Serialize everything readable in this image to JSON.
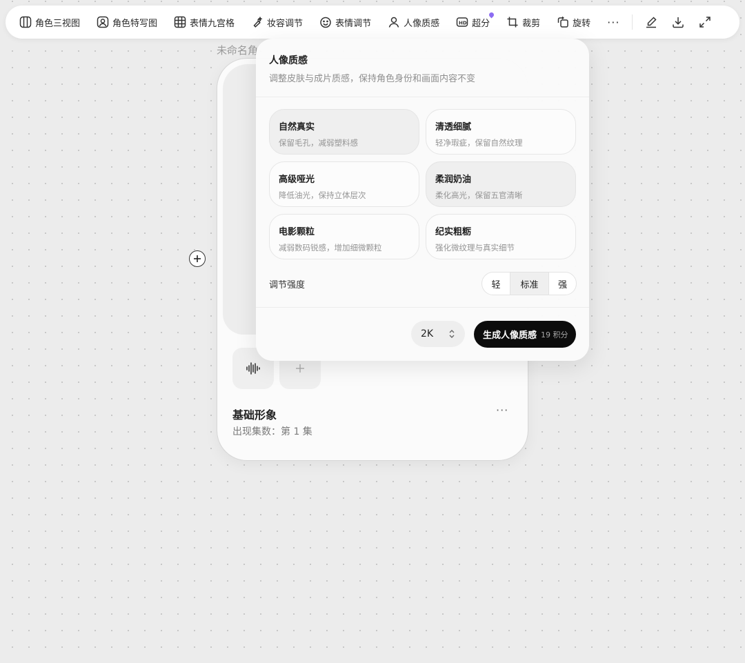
{
  "toolbar": {
    "items": [
      {
        "label": "角色三视图",
        "icon": "three-view-icon"
      },
      {
        "label": "角色特写图",
        "icon": "portrait-frame-icon"
      },
      {
        "label": "表情九宫格",
        "icon": "grid-icon"
      },
      {
        "label": "妆容调节",
        "icon": "makeup-brush-icon"
      },
      {
        "label": "表情调节",
        "icon": "smile-icon"
      },
      {
        "label": "人像质感",
        "icon": "person-icon"
      },
      {
        "label": "超分",
        "icon": "hd-icon"
      },
      {
        "label": "裁剪",
        "icon": "crop-icon"
      },
      {
        "label": "旋转",
        "icon": "rotate-icon"
      }
    ],
    "more": "···",
    "accent": "#8c6cf2"
  },
  "card": {
    "title": "未命名角",
    "name": "基础形象",
    "appearance": "出现集数：第 1 集",
    "more": "···"
  },
  "panel": {
    "title": "人像质感",
    "description": "调整皮肤与成片质感，保持角色身份和画面内容不变",
    "options": [
      {
        "name": "自然真实",
        "desc": "保留毛孔，减弱塑料感"
      },
      {
        "name": "清透细腻",
        "desc": "轻净瑕疵，保留自然纹理"
      },
      {
        "name": "高级哑光",
        "desc": "降低油光，保持立体层次"
      },
      {
        "name": "柔润奶油",
        "desc": "柔化高光，保留五官清晰"
      },
      {
        "name": "电影颗粒",
        "desc": "减弱数码锐感，增加细微颗粒"
      },
      {
        "name": "纪实粗粝",
        "desc": "强化微纹理与真实细节"
      }
    ],
    "strength_label": "调节强度",
    "strength_options": [
      "轻",
      "标准",
      "强"
    ],
    "strength_selected": "标准",
    "resolution": "2K",
    "generate_label": "生成人像质感",
    "generate_cost": "19 积分"
  }
}
